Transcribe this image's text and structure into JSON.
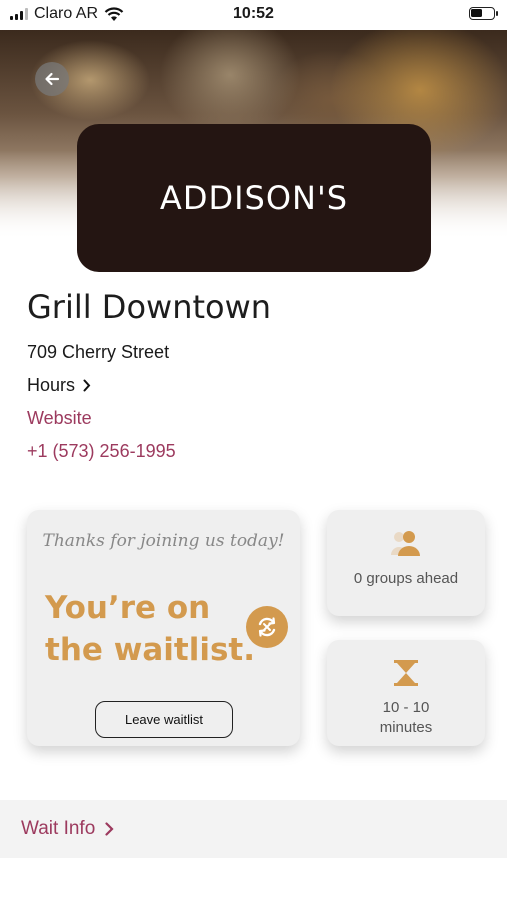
{
  "status_bar": {
    "carrier": "Claro AR",
    "time": "10:52"
  },
  "venue": {
    "brand_name": "ADDISON'S",
    "title": "Grill Downtown",
    "address": "709 Cherry Street",
    "hours_label": "Hours",
    "website_label": "Website",
    "phone": "+1 (573) 256-1995"
  },
  "waitlist": {
    "thanks_text": "Thanks for joining us today!",
    "status_line1": "You’re on",
    "status_line2": "the waitlist.",
    "leave_label": "Leave waitlist"
  },
  "stats": {
    "groups_ahead": "0 groups ahead",
    "wait_time_line1": "10 - 10",
    "wait_time_line2": "minutes"
  },
  "wait_info": {
    "label": "Wait Info"
  },
  "colors": {
    "accent": "#d39a4e",
    "link": "#9c3a5e",
    "brand_card": "#241512",
    "card_bg": "#efefef"
  },
  "icons": [
    "wifi-icon",
    "battery-icon",
    "back-arrow-icon",
    "chevron-right-icon",
    "refresh-icon",
    "person-icon",
    "hourglass-icon"
  ]
}
